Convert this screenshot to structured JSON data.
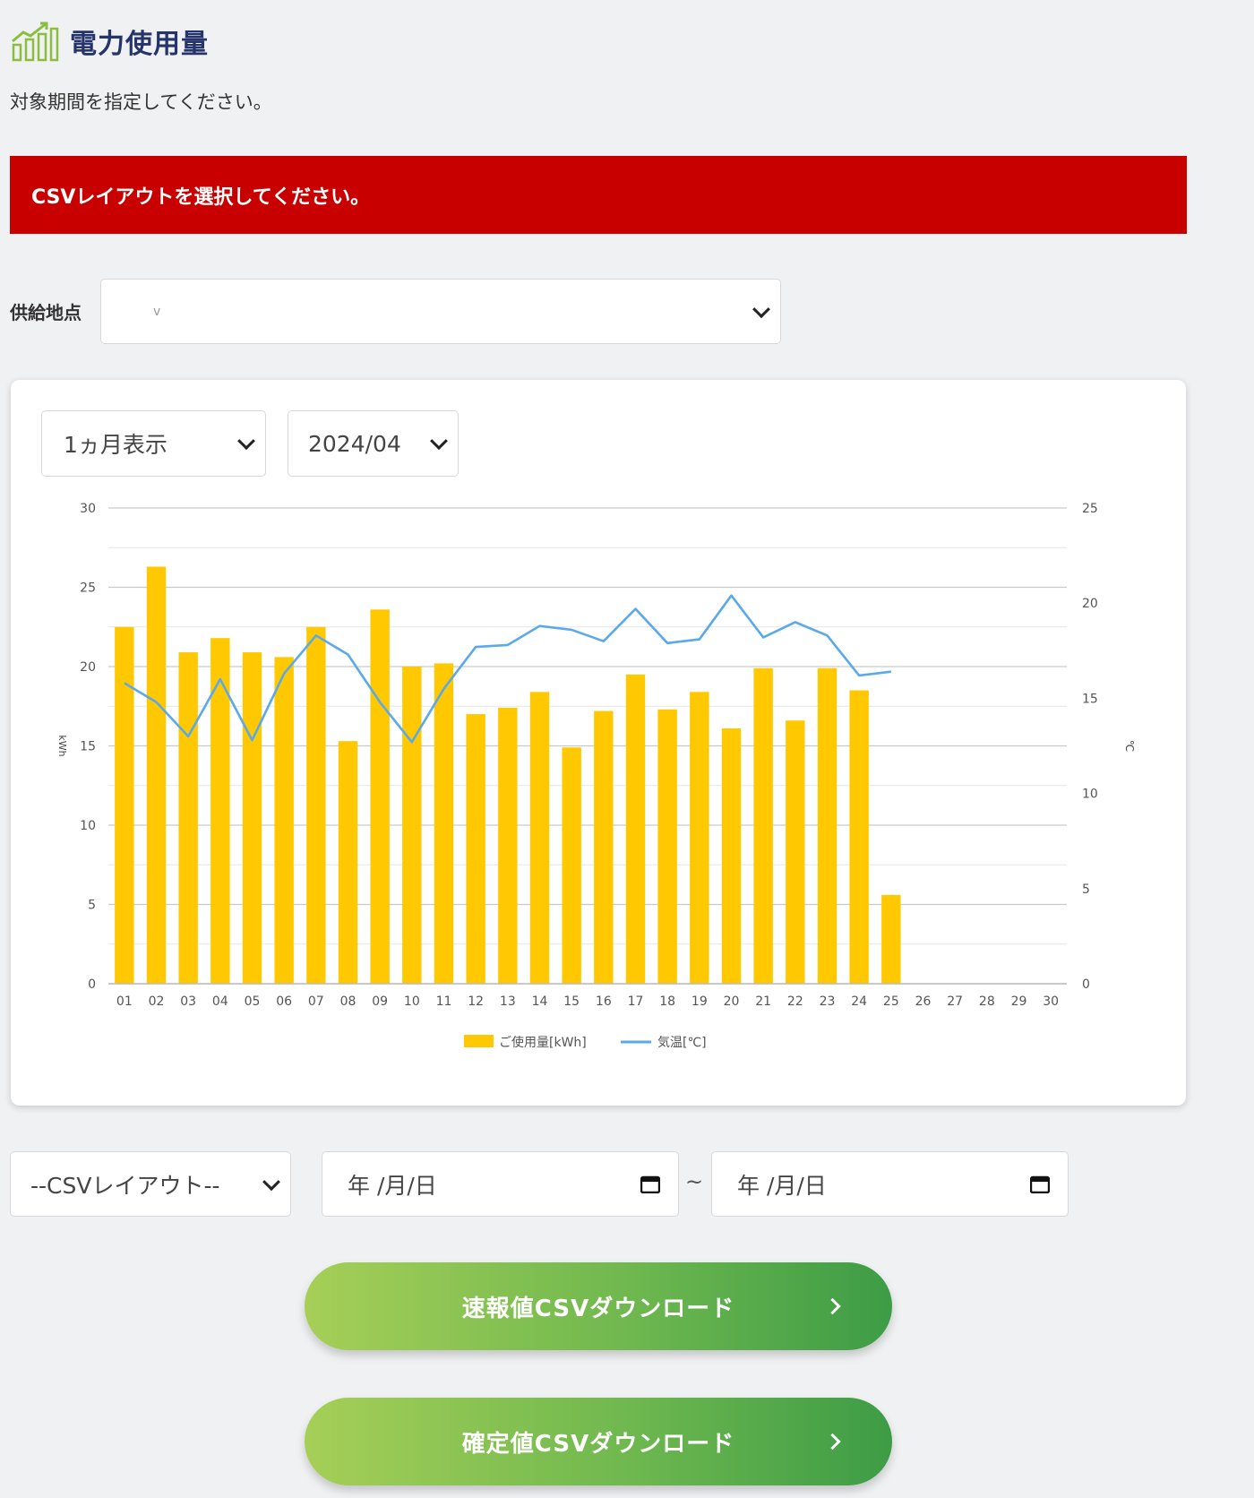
{
  "header": {
    "title": "電力使用量",
    "subtitle": "対象期間を指定してください。"
  },
  "error": {
    "message": "CSVレイアウトを選択してください。"
  },
  "supply_point": {
    "label": "供給地点",
    "value": "v"
  },
  "chart_controls": {
    "period": "1ヵ月表示",
    "month": "2024/04"
  },
  "chart_data": {
    "type": "bar",
    "categories": [
      "01",
      "02",
      "03",
      "04",
      "05",
      "06",
      "07",
      "08",
      "09",
      "10",
      "11",
      "12",
      "13",
      "14",
      "15",
      "16",
      "17",
      "18",
      "19",
      "20",
      "21",
      "22",
      "23",
      "24",
      "25",
      "26",
      "27",
      "28",
      "29",
      "30"
    ],
    "series": [
      {
        "name": "ご使用量[kWh]",
        "type": "bar",
        "axis": "left",
        "color": "#ffc800",
        "values": [
          22.5,
          26.3,
          20.9,
          21.8,
          20.9,
          20.6,
          22.5,
          15.3,
          23.6,
          20.0,
          20.2,
          17.0,
          17.4,
          18.4,
          14.9,
          17.2,
          19.5,
          17.3,
          18.4,
          16.1,
          19.9,
          16.6,
          19.9,
          18.5,
          5.6,
          null,
          null,
          null,
          null,
          null
        ]
      },
      {
        "name": "気温[℃]",
        "type": "line",
        "axis": "right",
        "color": "#5aa9ea",
        "values": [
          15.8,
          14.8,
          13.0,
          16.0,
          12.8,
          16.3,
          18.3,
          17.3,
          14.8,
          12.7,
          15.5,
          17.7,
          17.8,
          18.8,
          18.6,
          18.0,
          19.7,
          17.9,
          18.1,
          20.4,
          18.2,
          19.0,
          18.3,
          16.2,
          16.4,
          null,
          null,
          null,
          null,
          null
        ]
      }
    ],
    "y_left": {
      "label": "kWh",
      "ticks": [
        0,
        5,
        10,
        15,
        20,
        25,
        30
      ],
      "range": [
        0,
        30
      ]
    },
    "y_right": {
      "label": "℃",
      "ticks": [
        0,
        5,
        10,
        15,
        20,
        25
      ],
      "range": [
        0,
        25
      ]
    },
    "grid": true,
    "legend": "bottom"
  },
  "bottom_controls": {
    "csv_layout": "--CSVレイアウト--",
    "date_start": "年 /月/日",
    "date_separator": "~",
    "date_end": "年 /月/日"
  },
  "buttons": {
    "quick_download": "速報値CSVダウンロード",
    "final_download": "確定値CSVダウンロード"
  },
  "colors": {
    "error": "#c80000",
    "title": "#25346b",
    "bar": "#ffc800",
    "line": "#5aa9ea",
    "button_start": "#a6cf57",
    "button_end": "#3d9c46"
  }
}
